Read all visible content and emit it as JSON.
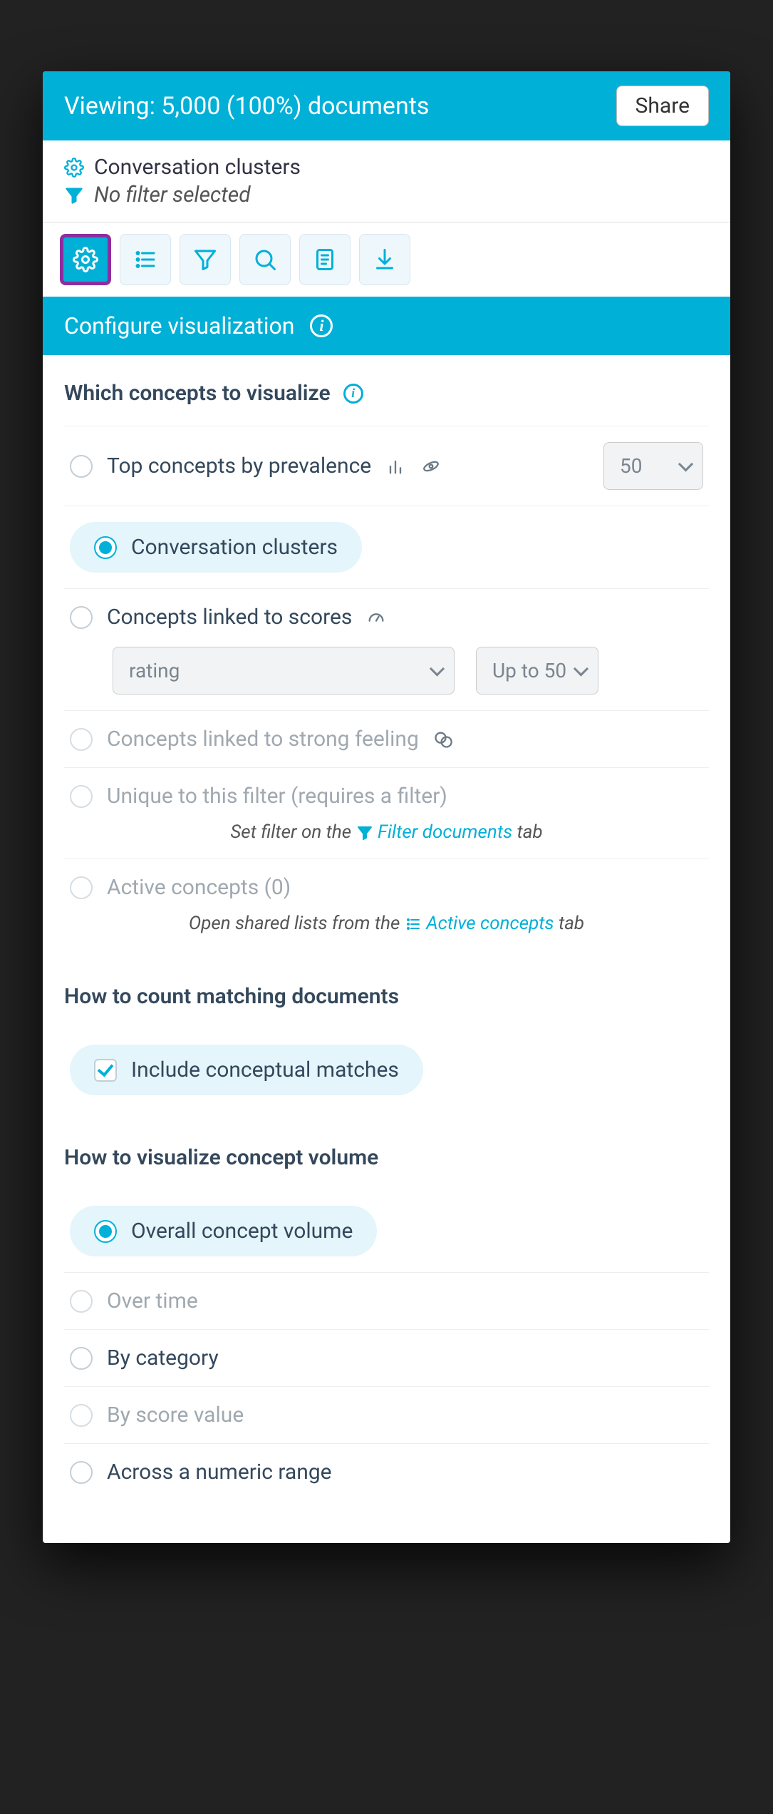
{
  "header": {
    "viewing_text": "Viewing: 5,000 (100%) documents",
    "share_label": "Share"
  },
  "meta": {
    "visualization_label": "Conversation clusters",
    "filter_label": "No filter selected"
  },
  "section": {
    "title": "Configure visualization"
  },
  "concepts": {
    "title": "Which concepts to visualize",
    "opt_top": "Top concepts by prevalence",
    "opt_top_count": "50",
    "opt_clusters": "Conversation clusters",
    "opt_scores": "Concepts linked to scores",
    "scores_field": "rating",
    "scores_limit": "Up to 50",
    "opt_feeling": "Concepts linked to strong feeling",
    "opt_unique": "Unique to this filter (requires a filter)",
    "unique_hint_pre": "Set filter on the",
    "unique_hint_link": "Filter documents",
    "unique_hint_post": "tab",
    "opt_active": "Active concepts (0)",
    "active_hint_pre": "Open shared lists from the",
    "active_hint_link": "Active concepts",
    "active_hint_post": "tab"
  },
  "counting": {
    "title": "How to count matching documents",
    "include_conceptual": "Include conceptual matches"
  },
  "volume": {
    "title": "How to visualize concept volume",
    "opt_overall": "Overall concept volume",
    "opt_time": "Over time",
    "opt_category": "By category",
    "opt_score": "By score value",
    "opt_numeric": "Across a numeric range"
  }
}
